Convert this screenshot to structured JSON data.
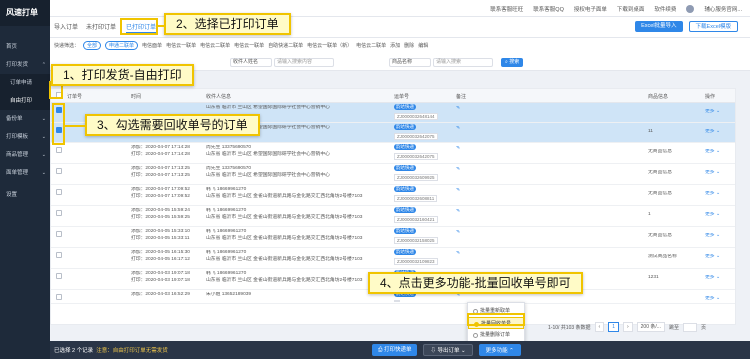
{
  "app": {
    "name": "风速打单"
  },
  "sidebar": {
    "items": [
      {
        "label": "首页"
      },
      {
        "label": "打印发货",
        "open": true
      },
      {
        "label": "订单申请"
      },
      {
        "label": "自由打印",
        "active": true
      },
      {
        "label": "备份单"
      },
      {
        "label": "打印模板"
      },
      {
        "label": "商品管理"
      },
      {
        "label": "面单管理"
      },
      {
        "label": "设置"
      }
    ]
  },
  "topbar": {
    "links": [
      "联系客服旺旺",
      "联系客服QQ",
      "授权电子面单",
      "下载到桌面",
      "软件续费",
      "辅心服务官网..."
    ]
  },
  "tabs": [
    {
      "label": "导入订单"
    },
    {
      "label": "未打印订单"
    },
    {
      "label": "已打印订单",
      "active": true
    },
    {
      "label": "关闭"
    }
  ],
  "top_actions": {
    "import_excel": "Excel批量导入",
    "download_template": "下载Excel模版"
  },
  "filters": {
    "label": "快递筛选：",
    "items": [
      "全部",
      "申通二联单",
      "电信面单",
      "电信云一联单",
      "电信云二联单",
      "电信云一联单",
      "自助快递二联单",
      "电信云一联单（新）",
      "电信云二联单"
    ],
    "links": [
      "添加",
      "删除",
      "编辑"
    ]
  },
  "search": {
    "field1": "收件人姓名",
    "field2": "请输入搜索内容",
    "field3": "商品名称",
    "field4": "请输入搜索",
    "button": "搜索"
  },
  "table": {
    "headers": [
      "订单号",
      "时间",
      "收件人信息",
      "运单号",
      "备注",
      "商品信息",
      "操作"
    ],
    "rows": [
      {
        "selected": true,
        "created": "",
        "printed": "",
        "recipient": "",
        "address": "山东省 临沂市 兰山区 希望国际国际研学社会中心营销中心",
        "carrier": "韵达快递",
        "waybill": "ZJ0000032648144",
        "goods": "",
        "op": "更多"
      },
      {
        "selected": true,
        "created": "",
        "printed": "",
        "recipient": "",
        "address": "山东省 临沂市 兰山区 希望国际国际研学社会中心营销中心",
        "carrier": "韵达快递",
        "waybill": "ZJ0000032642075",
        "goods": "11",
        "op": "更多"
      },
      {
        "selected": false,
        "created": "添加：2020-04-07 17:14:28",
        "printed": "打印：2020-04-07 17:14:28",
        "recipient": "周先生 13375690570",
        "address": "山东省 临沂市 兰山区 希望国际国际研学社会中心营销中心",
        "carrier": "韵达快递",
        "waybill": "ZJ0000032642075",
        "goods": "无商品信息",
        "op": "更多"
      },
      {
        "selected": false,
        "created": "添加：2020-04-07 17:13:25",
        "printed": "打印：2020-04-07 17:13:25",
        "recipient": "周先生 13375690570",
        "address": "山东省 临沂市 兰山区 希望国际国际研学社会中心营销中心",
        "carrier": "韵达快递",
        "waybill": "ZJ0000032609925",
        "goods": "无商品信息",
        "op": "更多"
      },
      {
        "selected": false,
        "created": "添加：2020-04-07 17:09:52",
        "printed": "打印：2020-04-07 17:09:52",
        "recipient": "韩飞 18669961270",
        "address": "山东省 临沂市 兰山区 金雀山街道新兵路与金化路交汇西北角坊2号楼7103",
        "carrier": "韵达快递",
        "waybill": "ZJ0000032608811",
        "goods": "无商品信息",
        "op": "更多"
      },
      {
        "selected": false,
        "created": "添加：2020-04-05 15:59:24",
        "printed": "打印：2020-04-05 15:59:25",
        "recipient": "韩飞 18669961270",
        "address": "山东省 临沂市 兰山区 金雀山街道新兵路与金化路交汇西北角坊2号楼7103",
        "carrier": "韵达快递",
        "waybill": "ZJ0000032160421",
        "goods": "1",
        "op": "更多"
      },
      {
        "selected": false,
        "created": "添加：2020-04-05 15:33:10",
        "printed": "打印：2020-04-05 15:33:11",
        "recipient": "韩飞 18669961270",
        "address": "山东省 临沂市 兰山区 金雀山街道新兵路与金化路交汇西北角坊2号楼7103",
        "carrier": "韵达快递",
        "waybill": "ZJ0000032158025",
        "goods": "无商品信息",
        "op": "更多"
      },
      {
        "selected": false,
        "created": "添加：2020-04-05 16:15:30",
        "printed": "打印：2020-04-05 16:17:12",
        "recipient": "韩飞 18669961270",
        "address": "山东省 临沂市 兰山区 金雀山街道新兵路与金化路交汇西北角坊2号楼7103",
        "carrier": "韵达快递",
        "waybill": "ZJ0000032109823",
        "goods": "测试商品名称",
        "op": "更多"
      },
      {
        "selected": false,
        "created": "添加：2020-04-03 19:07:18",
        "printed": "打印：2020-04-03 19:07:18",
        "recipient": "韩飞 18669961270",
        "address": "山东省 临沂市 兰山区 金雀山街道新兵路与金化路交汇西北角坊2号楼7103",
        "carrier": "韵达快递",
        "waybill": "ZJ0000032025923",
        "goods": "1231",
        "op": "更多"
      },
      {
        "selected": false,
        "created": "添加：2020-04-03 16:52:29",
        "printed": "",
        "recipient": "朱小姐 13652189039",
        "address": "",
        "carrier": "韵达快递",
        "waybill": "",
        "goods": "",
        "op": "更多"
      }
    ]
  },
  "pager": {
    "summary": "1-10/ 共103 条数据",
    "current": "1",
    "per_page": "200 条/...",
    "goto": "跳至",
    "page_suffix": "页"
  },
  "more_menu": {
    "items": [
      "批量重新取单",
      "批量回收单号",
      "批量删除订单"
    ],
    "highlighted_index": 1
  },
  "bottom": {
    "selected_info": "已选择 2 个记录",
    "hint": "注意：自由打印订单无需发货",
    "print_btn": "打印快递单",
    "export_btn": "导出订单",
    "more_btn": "更多功能"
  },
  "callouts": {
    "c1": "1、打印发货-自由打印",
    "c2": "2、选择已打印订单",
    "c3": "3、勾选需要回收单号的订单",
    "c4": "4、点击更多功能-批量回收单号即可"
  },
  "colors": {
    "primary": "#2f87e8",
    "sidebar": "#1e2a3a",
    "callout_bg": "#fffbc7",
    "callout_border": "#f0c400",
    "selected_row": "#cfe4f7"
  }
}
